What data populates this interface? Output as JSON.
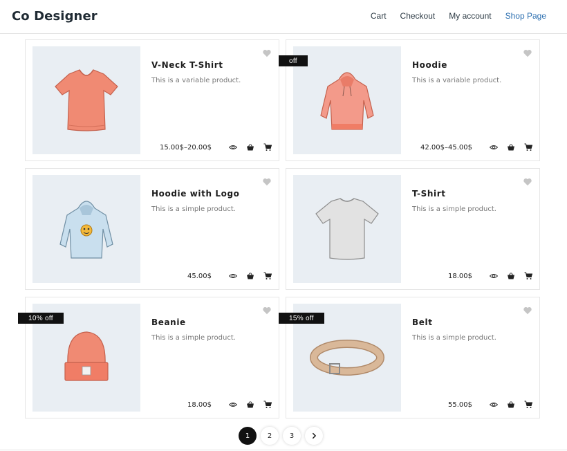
{
  "header": {
    "brand": "Co Designer",
    "nav": [
      {
        "label": "Cart"
      },
      {
        "label": "Checkout"
      },
      {
        "label": "My account"
      },
      {
        "label": "Shop Page"
      }
    ]
  },
  "products": [
    {
      "title": "V-Neck T-Shirt",
      "desc": "This is a variable product.",
      "price": "15.00$–20.00$",
      "badge": "",
      "image": "vneck-tshirt-image"
    },
    {
      "title": "Hoodie",
      "desc": "This is a variable product.",
      "price": "42.00$–45.00$",
      "badge": "off",
      "image": "hoodie-image"
    },
    {
      "title": "Hoodie with Logo",
      "desc": "This is a simple product.",
      "price": "45.00$",
      "badge": "",
      "image": "hoodie-logo-image"
    },
    {
      "title": "T-Shirt",
      "desc": "This is a simple product.",
      "price": "18.00$",
      "badge": "",
      "image": "tshirt-image"
    },
    {
      "title": "Beanie",
      "desc": "This is a simple product.",
      "price": "18.00$",
      "badge": "10% off",
      "image": "beanie-image"
    },
    {
      "title": "Belt",
      "desc": "This is a simple product.",
      "price": "55.00$",
      "badge": "15% off",
      "image": "belt-image"
    }
  ],
  "pagination": {
    "pages": [
      "1",
      "2",
      "3"
    ],
    "current": "1",
    "next_icon": "chevron-right-icon"
  },
  "colors": {
    "accent": "#2c6fb0",
    "badge_bg": "#111111",
    "thumb_bg": "#e9eef3"
  }
}
